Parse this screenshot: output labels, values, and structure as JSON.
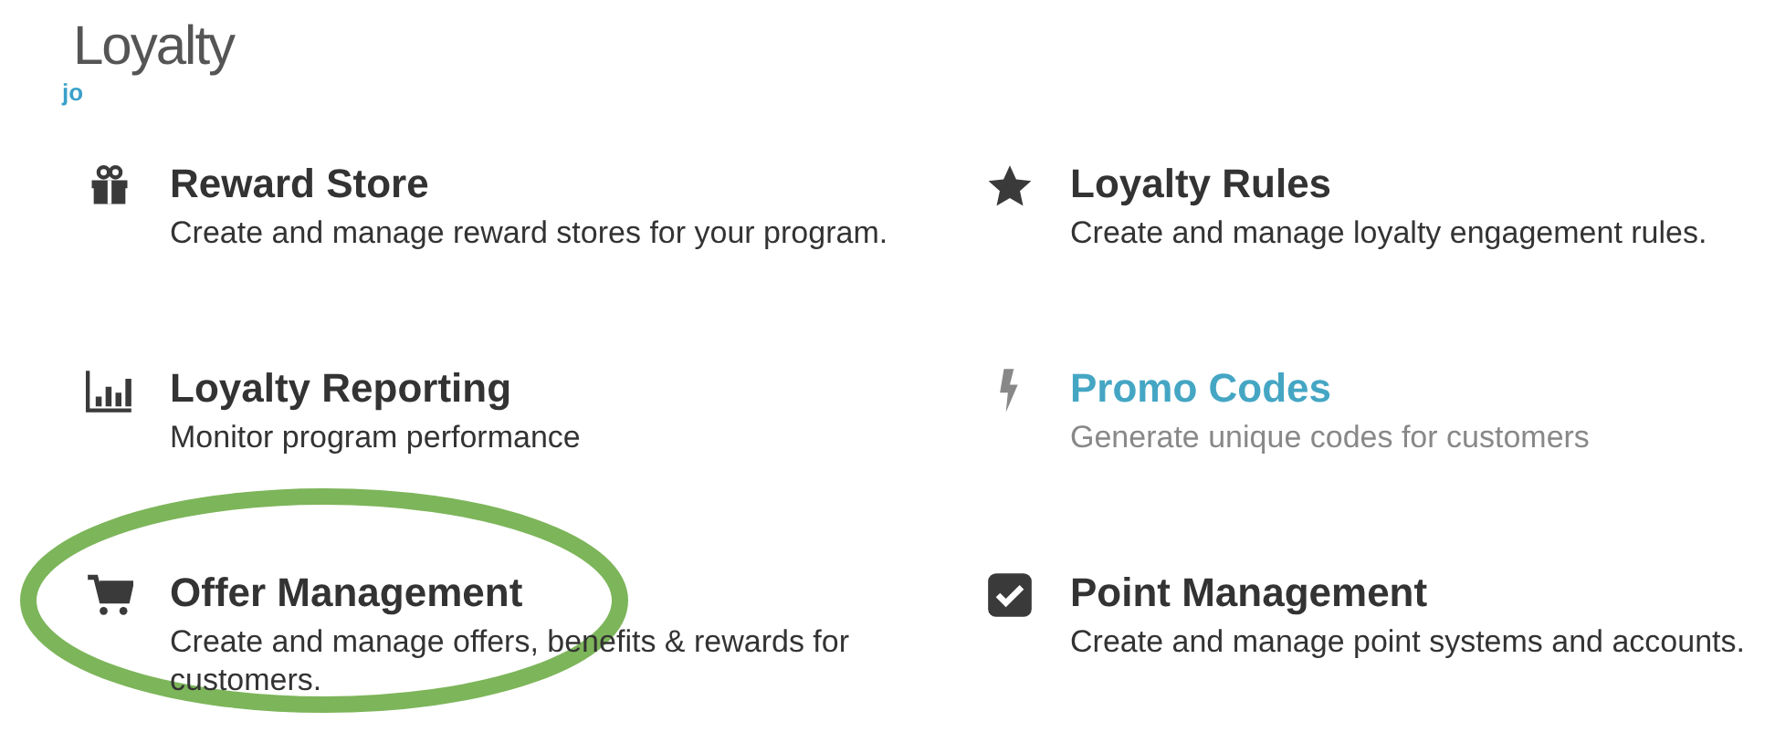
{
  "page": {
    "title": "Loyalty",
    "subtitle": "jo"
  },
  "items": [
    {
      "title": "Reward Store",
      "description": "Create and manage reward stores for your program.",
      "kind": "plain",
      "highlighted": false
    },
    {
      "title": "Loyalty Rules",
      "description": "Create and manage loyalty engagement rules.",
      "kind": "plain",
      "highlighted": false
    },
    {
      "title": "Loyalty Reporting",
      "description": "Monitor program performance",
      "kind": "plain",
      "highlighted": false
    },
    {
      "title": "Promo Codes",
      "description": "Generate unique codes for customers",
      "kind": "link",
      "highlighted": false
    },
    {
      "title": "Offer Management",
      "description": "Create and manage offers, benefits & rewards for customers.",
      "kind": "plain",
      "highlighted": true
    },
    {
      "title": "Point Management",
      "description": "Create and manage point systems and accounts.",
      "kind": "plain",
      "highlighted": false
    }
  ]
}
